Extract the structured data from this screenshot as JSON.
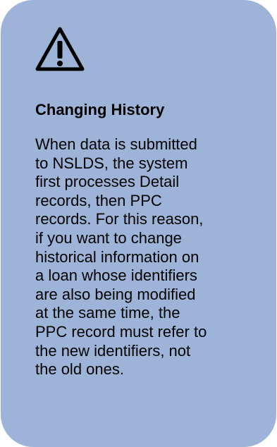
{
  "callout": {
    "icon": "warning-icon",
    "title": "Changing History",
    "body_lines": [
      "When data is submitted",
      "to NSLDS, the system",
      "first processes Detail",
      "records, then PPC",
      "records. For this reason,",
      "if you want to change",
      "historical information on",
      "a loan whose identifiers",
      "are also being modified",
      "at the same time, the",
      "PPC record must refer to",
      "the new identifiers, not",
      "the old ones."
    ],
    "colors": {
      "background": "#9db4d8",
      "text": "#000000"
    }
  }
}
